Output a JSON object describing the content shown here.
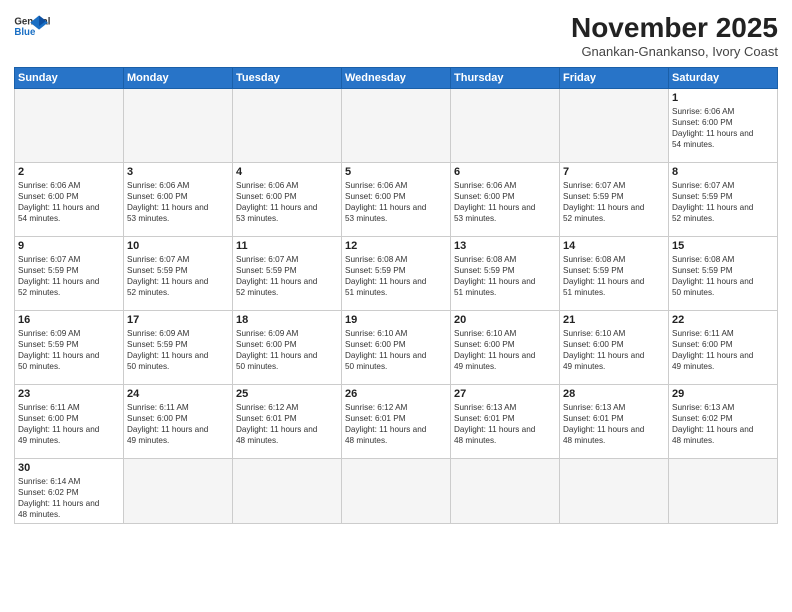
{
  "header": {
    "logo_general": "General",
    "logo_blue": "Blue",
    "month_title": "November 2025",
    "location": "Gnankan-Gnankanso, Ivory Coast"
  },
  "days_of_week": [
    "Sunday",
    "Monday",
    "Tuesday",
    "Wednesday",
    "Thursday",
    "Friday",
    "Saturday"
  ],
  "weeks": [
    [
      {
        "day": "",
        "empty": true
      },
      {
        "day": "",
        "empty": true
      },
      {
        "day": "",
        "empty": true
      },
      {
        "day": "",
        "empty": true
      },
      {
        "day": "",
        "empty": true
      },
      {
        "day": "",
        "empty": true
      },
      {
        "day": "1",
        "sunrise": "6:06 AM",
        "sunset": "6:00 PM",
        "daylight": "11 hours and 54 minutes."
      }
    ],
    [
      {
        "day": "2",
        "sunrise": "6:06 AM",
        "sunset": "6:00 PM",
        "daylight": "11 hours and 54 minutes."
      },
      {
        "day": "3",
        "sunrise": "6:06 AM",
        "sunset": "6:00 PM",
        "daylight": "11 hours and 53 minutes."
      },
      {
        "day": "4",
        "sunrise": "6:06 AM",
        "sunset": "6:00 PM",
        "daylight": "11 hours and 53 minutes."
      },
      {
        "day": "5",
        "sunrise": "6:06 AM",
        "sunset": "6:00 PM",
        "daylight": "11 hours and 53 minutes."
      },
      {
        "day": "6",
        "sunrise": "6:06 AM",
        "sunset": "6:00 PM",
        "daylight": "11 hours and 53 minutes."
      },
      {
        "day": "7",
        "sunrise": "6:07 AM",
        "sunset": "5:59 PM",
        "daylight": "11 hours and 52 minutes."
      },
      {
        "day": "8",
        "sunrise": "6:07 AM",
        "sunset": "5:59 PM",
        "daylight": "11 hours and 52 minutes."
      }
    ],
    [
      {
        "day": "9",
        "sunrise": "6:07 AM",
        "sunset": "5:59 PM",
        "daylight": "11 hours and 52 minutes."
      },
      {
        "day": "10",
        "sunrise": "6:07 AM",
        "sunset": "5:59 PM",
        "daylight": "11 hours and 52 minutes."
      },
      {
        "day": "11",
        "sunrise": "6:07 AM",
        "sunset": "5:59 PM",
        "daylight": "11 hours and 52 minutes."
      },
      {
        "day": "12",
        "sunrise": "6:08 AM",
        "sunset": "5:59 PM",
        "daylight": "11 hours and 51 minutes."
      },
      {
        "day": "13",
        "sunrise": "6:08 AM",
        "sunset": "5:59 PM",
        "daylight": "11 hours and 51 minutes."
      },
      {
        "day": "14",
        "sunrise": "6:08 AM",
        "sunset": "5:59 PM",
        "daylight": "11 hours and 51 minutes."
      },
      {
        "day": "15",
        "sunrise": "6:08 AM",
        "sunset": "5:59 PM",
        "daylight": "11 hours and 50 minutes."
      }
    ],
    [
      {
        "day": "16",
        "sunrise": "6:09 AM",
        "sunset": "5:59 PM",
        "daylight": "11 hours and 50 minutes."
      },
      {
        "day": "17",
        "sunrise": "6:09 AM",
        "sunset": "5:59 PM",
        "daylight": "11 hours and 50 minutes."
      },
      {
        "day": "18",
        "sunrise": "6:09 AM",
        "sunset": "6:00 PM",
        "daylight": "11 hours and 50 minutes."
      },
      {
        "day": "19",
        "sunrise": "6:10 AM",
        "sunset": "6:00 PM",
        "daylight": "11 hours and 50 minutes."
      },
      {
        "day": "20",
        "sunrise": "6:10 AM",
        "sunset": "6:00 PM",
        "daylight": "11 hours and 49 minutes."
      },
      {
        "day": "21",
        "sunrise": "6:10 AM",
        "sunset": "6:00 PM",
        "daylight": "11 hours and 49 minutes."
      },
      {
        "day": "22",
        "sunrise": "6:11 AM",
        "sunset": "6:00 PM",
        "daylight": "11 hours and 49 minutes."
      }
    ],
    [
      {
        "day": "23",
        "sunrise": "6:11 AM",
        "sunset": "6:00 PM",
        "daylight": "11 hours and 49 minutes."
      },
      {
        "day": "24",
        "sunrise": "6:11 AM",
        "sunset": "6:00 PM",
        "daylight": "11 hours and 49 minutes."
      },
      {
        "day": "25",
        "sunrise": "6:12 AM",
        "sunset": "6:01 PM",
        "daylight": "11 hours and 48 minutes."
      },
      {
        "day": "26",
        "sunrise": "6:12 AM",
        "sunset": "6:01 PM",
        "daylight": "11 hours and 48 minutes."
      },
      {
        "day": "27",
        "sunrise": "6:13 AM",
        "sunset": "6:01 PM",
        "daylight": "11 hours and 48 minutes."
      },
      {
        "day": "28",
        "sunrise": "6:13 AM",
        "sunset": "6:01 PM",
        "daylight": "11 hours and 48 minutes."
      },
      {
        "day": "29",
        "sunrise": "6:13 AM",
        "sunset": "6:02 PM",
        "daylight": "11 hours and 48 minutes."
      }
    ],
    [
      {
        "day": "30",
        "sunrise": "6:14 AM",
        "sunset": "6:02 PM",
        "daylight": "11 hours and 48 minutes.",
        "last": true
      },
      {
        "day": "",
        "empty": true,
        "last": true
      },
      {
        "day": "",
        "empty": true,
        "last": true
      },
      {
        "day": "",
        "empty": true,
        "last": true
      },
      {
        "day": "",
        "empty": true,
        "last": true
      },
      {
        "day": "",
        "empty": true,
        "last": true
      },
      {
        "day": "",
        "empty": true,
        "last": true
      }
    ]
  ]
}
